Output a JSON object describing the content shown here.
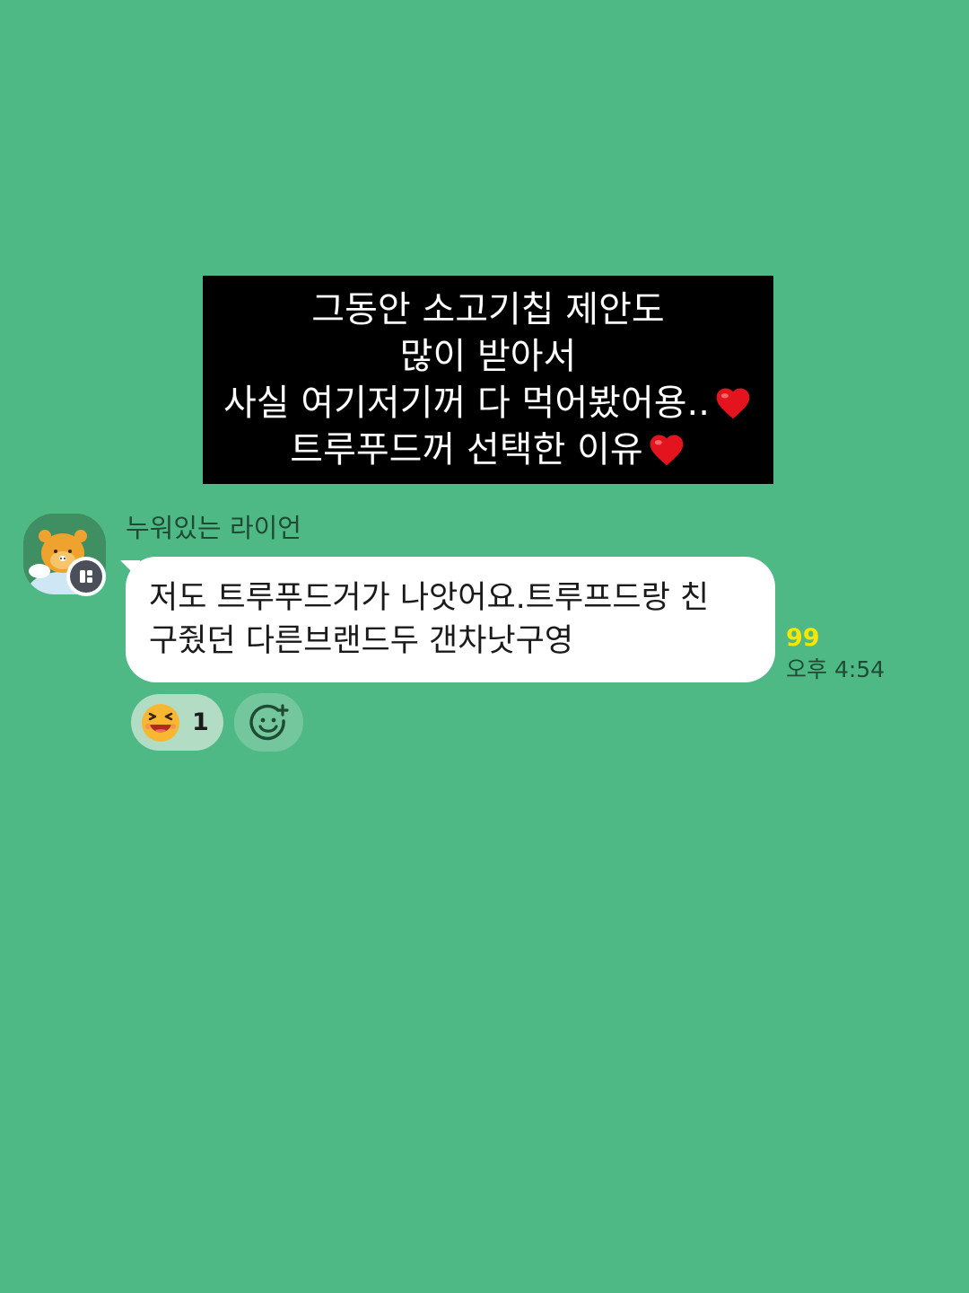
{
  "caption": {
    "lines": [
      "그동안 소고기칩 제안도",
      "많이 받아서",
      "사실 여기저기꺼 다 먹어봤어용..",
      "트루푸드꺼 선택한 이유"
    ],
    "line3_emoji": "heart-icon",
    "line4_emoji": "heart-icon"
  },
  "message": {
    "sender_name": "누워있는 라이언",
    "lines": [
      "저도 트루푸드거가 나앗어요.트루프드랑 친",
      "구줬던 다른브랜드두 갠차낫구영"
    ],
    "unread_count": "99",
    "time": "오후 4:54"
  },
  "reactions": {
    "emoji": "laughing-face-icon",
    "count": "1",
    "add_icon": "add-reaction-icon"
  },
  "colors": {
    "background": "#4fb985",
    "unread": "#f7e600",
    "bubble": "#ffffff",
    "caption_box": "#000000"
  }
}
